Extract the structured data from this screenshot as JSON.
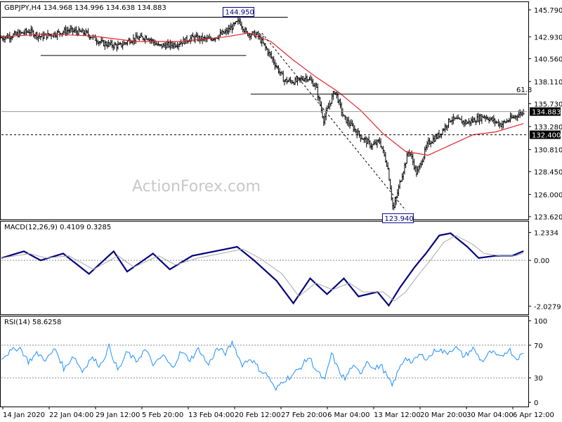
{
  "watermark": "ActionForex.com",
  "colors": {
    "price_bars": "#000000",
    "moving_average": "#e0262e",
    "macd_line": "#000080",
    "signal_line": "#aaaaaa",
    "rsi_line": "#1e90ff",
    "label_border": "#000080"
  },
  "chart_data": [
    {
      "type": "ohlc",
      "panel": "price",
      "header": "GBPJPY,H4  134.968 134.996 134.638 134.883",
      "symbol": "GBPJPY",
      "timeframe": "H4",
      "ohlc_last": {
        "open": 134.968,
        "high": 134.996,
        "low": 134.638,
        "close": 134.883
      },
      "ylim": [
        123.62,
        145.79
      ],
      "yticks": [
        145.79,
        142.9,
        140.56,
        138.11,
        135.73,
        133.28,
        130.81,
        128.45,
        126.0,
        123.62
      ],
      "ytick_labels": [
        "145.790",
        "142.930",
        "140.560",
        "138.110",
        "135.730",
        "133.280",
        "130.810",
        "128.450",
        "126.000",
        "123.620"
      ],
      "xtick_labels": [
        "14 Jan 2020",
        "22 Jan 04:00",
        "29 Jan 12:00",
        "5 Feb 20:00",
        "13 Feb 04:00",
        "20 Feb 12:00",
        "27 Feb 20:00",
        "6 Mar 04:00",
        "13 Mar 12:00",
        "20 Mar 20:00",
        "30 Mar 04:00",
        "6 Apr 12:00"
      ],
      "bar_count": 440,
      "price_path": [
        {
          "bar": 0,
          "price": 142.8
        },
        {
          "bar": 12,
          "price": 143.1
        },
        {
          "bar": 25,
          "price": 143.5
        },
        {
          "bar": 35,
          "price": 142.9
        },
        {
          "bar": 50,
          "price": 143.3
        },
        {
          "bar": 60,
          "price": 143.6
        },
        {
          "bar": 75,
          "price": 143.3
        },
        {
          "bar": 90,
          "price": 142.2
        },
        {
          "bar": 105,
          "price": 141.9
        },
        {
          "bar": 115,
          "price": 142.6
        },
        {
          "bar": 130,
          "price": 142.9
        },
        {
          "bar": 140,
          "price": 141.9
        },
        {
          "bar": 155,
          "price": 142.1
        },
        {
          "bar": 170,
          "price": 142.8
        },
        {
          "bar": 185,
          "price": 142.6
        },
        {
          "bar": 200,
          "price": 143.4
        },
        {
          "bar": 212,
          "price": 144.6
        },
        {
          "bar": 218,
          "price": 143.3
        },
        {
          "bar": 228,
          "price": 143.1
        },
        {
          "bar": 240,
          "price": 140.8
        },
        {
          "bar": 252,
          "price": 138.2
        },
        {
          "bar": 262,
          "price": 138.1
        },
        {
          "bar": 272,
          "price": 138.6
        },
        {
          "bar": 280,
          "price": 137.6
        },
        {
          "bar": 287,
          "price": 134.0
        },
        {
          "bar": 297,
          "price": 137.2
        },
        {
          "bar": 305,
          "price": 134.2
        },
        {
          "bar": 313,
          "price": 133.2
        },
        {
          "bar": 320,
          "price": 132.2
        },
        {
          "bar": 330,
          "price": 131.2
        },
        {
          "bar": 337,
          "price": 131.7
        },
        {
          "bar": 344,
          "price": 129.0
        },
        {
          "bar": 349,
          "price": 124.3
        },
        {
          "bar": 355,
          "price": 127.3
        },
        {
          "bar": 363,
          "price": 130.8
        },
        {
          "bar": 370,
          "price": 128.2
        },
        {
          "bar": 380,
          "price": 131.5
        },
        {
          "bar": 390,
          "price": 132.4
        },
        {
          "bar": 400,
          "price": 134.1
        },
        {
          "bar": 415,
          "price": 133.7
        },
        {
          "bar": 430,
          "price": 134.4
        },
        {
          "bar": 445,
          "price": 133.5
        },
        {
          "bar": 455,
          "price": 134.2
        },
        {
          "bar": 465,
          "price": 134.9
        }
      ],
      "moving_average_path": [
        {
          "bar": 0,
          "price": 142.9
        },
        {
          "bar": 40,
          "price": 143.2
        },
        {
          "bar": 80,
          "price": 143.0
        },
        {
          "bar": 120,
          "price": 142.4
        },
        {
          "bar": 160,
          "price": 142.4
        },
        {
          "bar": 200,
          "price": 142.9
        },
        {
          "bar": 220,
          "price": 143.3
        },
        {
          "bar": 240,
          "price": 142.4
        },
        {
          "bar": 260,
          "price": 140.4
        },
        {
          "bar": 280,
          "price": 138.6
        },
        {
          "bar": 300,
          "price": 137.0
        },
        {
          "bar": 320,
          "price": 135.0
        },
        {
          "bar": 340,
          "price": 132.5
        },
        {
          "bar": 360,
          "price": 130.6
        },
        {
          "bar": 380,
          "price": 130.2
        },
        {
          "bar": 400,
          "price": 131.3
        },
        {
          "bar": 420,
          "price": 132.4
        },
        {
          "bar": 440,
          "price": 132.7
        },
        {
          "bar": 465,
          "price": 133.6
        }
      ],
      "price_labels": [
        {
          "text": "144.950",
          "bar": 198,
          "price": 145.0
        },
        {
          "text": "123.940",
          "bar": 340,
          "price": 123.94
        }
      ],
      "horizontal_lines": [
        {
          "price": 145.0,
          "from_bar": 0,
          "to_bar": 255,
          "style": "solid"
        },
        {
          "price": 140.9,
          "from_bar": 35,
          "to_bar": 218,
          "style": "solid"
        },
        {
          "price": 136.75,
          "from_bar": 222,
          "to_bar": 468,
          "style": "solid",
          "label": "61.8"
        },
        {
          "price": 134.883,
          "from_bar": 0,
          "to_bar": 468,
          "style": "solid-grey",
          "tag": "134.883"
        },
        {
          "price": 132.4,
          "from_bar": 0,
          "to_bar": 468,
          "style": "dashed",
          "tag": "132.400"
        }
      ],
      "trend_lines": [
        {
          "from_bar": 232,
          "from_price": 143.3,
          "to_bar": 360,
          "to_price": 124.3,
          "style": "dashed"
        }
      ]
    },
    {
      "type": "line",
      "panel": "macd",
      "header": "MACD(12,26,9) 0.4109 0.3285",
      "params": "12,26,9",
      "macd_value": 0.4109,
      "signal_value": 0.3285,
      "ylim": [
        -2.3,
        1.5
      ],
      "ytick_labels": [
        "1.2334",
        "0.00",
        "-2.0279"
      ],
      "yticks": [
        1.2334,
        0.0,
        -2.0279
      ],
      "series": [
        {
          "name": "MACD",
          "points": [
            {
              "bar": 0,
              "v": 0.1
            },
            {
              "bar": 20,
              "v": 0.4
            },
            {
              "bar": 35,
              "v": 0.0
            },
            {
              "bar": 55,
              "v": 0.3
            },
            {
              "bar": 78,
              "v": -0.6
            },
            {
              "bar": 100,
              "v": 0.4
            },
            {
              "bar": 112,
              "v": -0.5
            },
            {
              "bar": 135,
              "v": 0.3
            },
            {
              "bar": 150,
              "v": -0.4
            },
            {
              "bar": 170,
              "v": 0.2
            },
            {
              "bar": 190,
              "v": 0.4
            },
            {
              "bar": 210,
              "v": 0.6
            },
            {
              "bar": 225,
              "v": 0.0
            },
            {
              "bar": 245,
              "v": -0.9
            },
            {
              "bar": 260,
              "v": -1.9
            },
            {
              "bar": 275,
              "v": -0.8
            },
            {
              "bar": 290,
              "v": -1.5
            },
            {
              "bar": 305,
              "v": -0.8
            },
            {
              "bar": 318,
              "v": -1.6
            },
            {
              "bar": 335,
              "v": -1.4
            },
            {
              "bar": 345,
              "v": -2.0
            },
            {
              "bar": 355,
              "v": -1.2
            },
            {
              "bar": 368,
              "v": -0.3
            },
            {
              "bar": 378,
              "v": 0.3
            },
            {
              "bar": 390,
              "v": 1.1
            },
            {
              "bar": 400,
              "v": 1.2
            },
            {
              "bar": 415,
              "v": 0.6
            },
            {
              "bar": 425,
              "v": 0.1
            },
            {
              "bar": 440,
              "v": 0.2
            },
            {
              "bar": 455,
              "v": 0.2
            },
            {
              "bar": 465,
              "v": 0.41
            }
          ]
        },
        {
          "name": "Signal",
          "points": [
            {
              "bar": 0,
              "v": 0.1
            },
            {
              "bar": 25,
              "v": 0.3
            },
            {
              "bar": 40,
              "v": 0.1
            },
            {
              "bar": 60,
              "v": 0.2
            },
            {
              "bar": 82,
              "v": -0.4
            },
            {
              "bar": 104,
              "v": 0.2
            },
            {
              "bar": 118,
              "v": -0.3
            },
            {
              "bar": 140,
              "v": 0.2
            },
            {
              "bar": 155,
              "v": -0.2
            },
            {
              "bar": 175,
              "v": 0.1
            },
            {
              "bar": 195,
              "v": 0.3
            },
            {
              "bar": 215,
              "v": 0.5
            },
            {
              "bar": 230,
              "v": 0.1
            },
            {
              "bar": 250,
              "v": -0.6
            },
            {
              "bar": 265,
              "v": -1.6
            },
            {
              "bar": 280,
              "v": -1.0
            },
            {
              "bar": 295,
              "v": -1.3
            },
            {
              "bar": 310,
              "v": -1.0
            },
            {
              "bar": 322,
              "v": -1.4
            },
            {
              "bar": 340,
              "v": -1.4
            },
            {
              "bar": 350,
              "v": -1.8
            },
            {
              "bar": 360,
              "v": -1.4
            },
            {
              "bar": 372,
              "v": -0.6
            },
            {
              "bar": 382,
              "v": 0.0
            },
            {
              "bar": 394,
              "v": 0.8
            },
            {
              "bar": 405,
              "v": 1.1
            },
            {
              "bar": 420,
              "v": 0.7
            },
            {
              "bar": 430,
              "v": 0.3
            },
            {
              "bar": 445,
              "v": 0.2
            },
            {
              "bar": 458,
              "v": 0.2
            },
            {
              "bar": 465,
              "v": 0.33
            }
          ]
        }
      ]
    },
    {
      "type": "line",
      "panel": "rsi",
      "header": "RSI(14) 58.6258",
      "period": 14,
      "rsi_value": 58.6258,
      "ylim": [
        0,
        100
      ],
      "yticks": [
        100,
        70,
        30,
        0
      ],
      "ytick_labels": [
        "100",
        "70",
        "30",
        "0"
      ],
      "levels": [
        70,
        30
      ],
      "series": [
        {
          "name": "RSI",
          "points": [
            {
              "bar": 0,
              "v": 55
            },
            {
              "bar": 8,
              "v": 62
            },
            {
              "bar": 16,
              "v": 68
            },
            {
              "bar": 24,
              "v": 50
            },
            {
              "bar": 32,
              "v": 60
            },
            {
              "bar": 40,
              "v": 52
            },
            {
              "bar": 48,
              "v": 66
            },
            {
              "bar": 56,
              "v": 40
            },
            {
              "bar": 64,
              "v": 58
            },
            {
              "bar": 72,
              "v": 38
            },
            {
              "bar": 80,
              "v": 55
            },
            {
              "bar": 88,
              "v": 45
            },
            {
              "bar": 96,
              "v": 68
            },
            {
              "bar": 104,
              "v": 38
            },
            {
              "bar": 112,
              "v": 62
            },
            {
              "bar": 120,
              "v": 50
            },
            {
              "bar": 128,
              "v": 65
            },
            {
              "bar": 136,
              "v": 45
            },
            {
              "bar": 144,
              "v": 58
            },
            {
              "bar": 152,
              "v": 42
            },
            {
              "bar": 160,
              "v": 62
            },
            {
              "bar": 168,
              "v": 52
            },
            {
              "bar": 176,
              "v": 66
            },
            {
              "bar": 184,
              "v": 45
            },
            {
              "bar": 192,
              "v": 66
            },
            {
              "bar": 200,
              "v": 60
            },
            {
              "bar": 206,
              "v": 74
            },
            {
              "bar": 214,
              "v": 46
            },
            {
              "bar": 222,
              "v": 54
            },
            {
              "bar": 230,
              "v": 40
            },
            {
              "bar": 238,
              "v": 32
            },
            {
              "bar": 244,
              "v": 14
            },
            {
              "bar": 250,
              "v": 26
            },
            {
              "bar": 258,
              "v": 32
            },
            {
              "bar": 266,
              "v": 42
            },
            {
              "bar": 274,
              "v": 56
            },
            {
              "bar": 280,
              "v": 40
            },
            {
              "bar": 288,
              "v": 26
            },
            {
              "bar": 294,
              "v": 60
            },
            {
              "bar": 300,
              "v": 40
            },
            {
              "bar": 306,
              "v": 28
            },
            {
              "bar": 312,
              "v": 44
            },
            {
              "bar": 320,
              "v": 36
            },
            {
              "bar": 326,
              "v": 52
            },
            {
              "bar": 332,
              "v": 40
            },
            {
              "bar": 338,
              "v": 46
            },
            {
              "bar": 344,
              "v": 30
            },
            {
              "bar": 348,
              "v": 20
            },
            {
              "bar": 354,
              "v": 40
            },
            {
              "bar": 360,
              "v": 56
            },
            {
              "bar": 366,
              "v": 48
            },
            {
              "bar": 372,
              "v": 58
            },
            {
              "bar": 380,
              "v": 54
            },
            {
              "bar": 388,
              "v": 66
            },
            {
              "bar": 396,
              "v": 60
            },
            {
              "bar": 404,
              "v": 68
            },
            {
              "bar": 412,
              "v": 56
            },
            {
              "bar": 420,
              "v": 66
            },
            {
              "bar": 428,
              "v": 50
            },
            {
              "bar": 436,
              "v": 62
            },
            {
              "bar": 444,
              "v": 54
            },
            {
              "bar": 452,
              "v": 66
            },
            {
              "bar": 458,
              "v": 54
            },
            {
              "bar": 465,
              "v": 59
            }
          ]
        }
      ]
    }
  ]
}
